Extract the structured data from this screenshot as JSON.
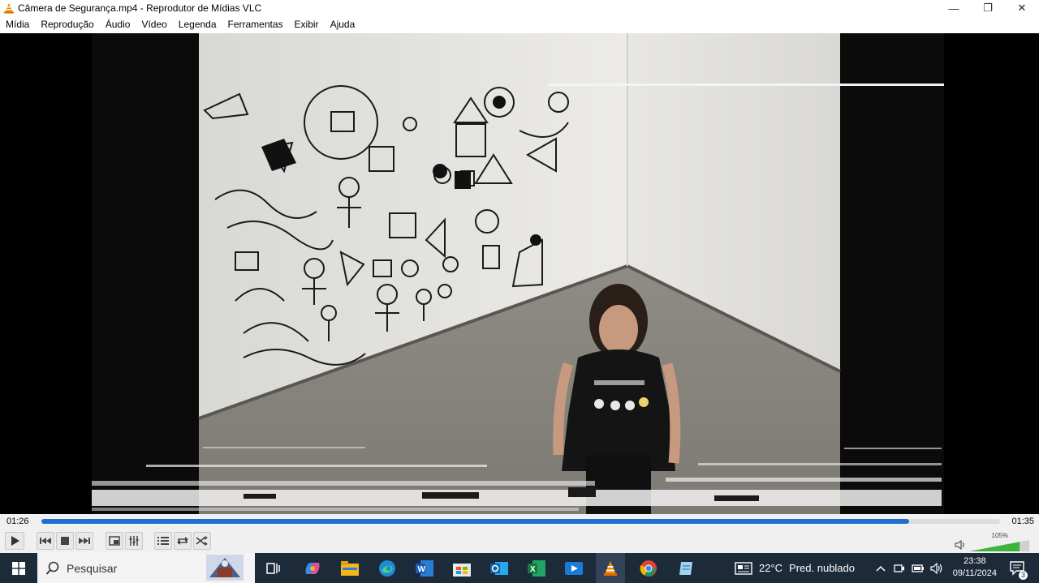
{
  "window": {
    "title": "Câmera de Segurança.mp4 - Reprodutor de Mídias VLC",
    "minimize_glyph": "—",
    "restore_glyph": "❐",
    "close_glyph": "✕"
  },
  "menu": {
    "items": [
      "Mídia",
      "Reprodução",
      "Áudio",
      "Vídeo",
      "Legenda",
      "Ferramentas",
      "Exibir",
      "Ajuda"
    ]
  },
  "player": {
    "current_time": "01:26",
    "total_time": "01:35",
    "progress_fraction": 0.905,
    "volume_label": "105%",
    "volume_fraction": 1.05,
    "accent_color": "#1f6fd1"
  },
  "controls": {
    "icons": [
      "play-icon",
      "previous-icon",
      "stop-icon",
      "next-icon",
      "fullscreen-icon",
      "extended-settings-icon",
      "playlist-icon",
      "loop-icon",
      "shuffle-icon",
      "speaker-icon"
    ]
  },
  "taskbar": {
    "search_placeholder": "Pesquisar",
    "weather_temp": "22°C",
    "weather_desc": "Pred. nublado",
    "time": "23:38",
    "date": "09/11/2024",
    "notification_count": "3",
    "apps": [
      "task-view-icon",
      "copilot-icon",
      "file-explorer-icon",
      "edge-icon",
      "word-icon",
      "store-icon",
      "outlook-icon",
      "excel-icon",
      "media-player-icon",
      "vlc-icon",
      "chrome-icon",
      "notepad-icon"
    ]
  }
}
